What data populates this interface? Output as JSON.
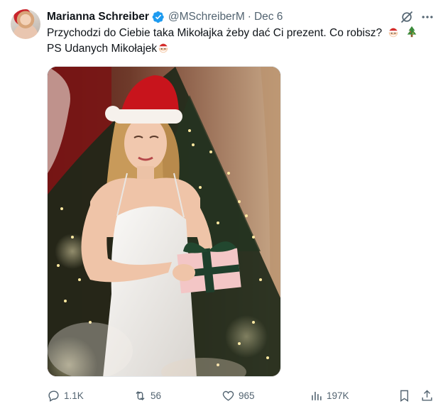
{
  "author": {
    "name": "Marianna Schreiber",
    "handle": "@MSchreiberM",
    "separator": "·",
    "date": "Dec 6"
  },
  "tweet": {
    "line1": "Przychodzi do Ciebie taka Mikołajka żeby dać Ci prezent. Co robisz?",
    "line2": "PS Udanych Mikołajek",
    "emojis_line1": [
      "santa-emoji",
      "christmas-tree-emoji"
    ],
    "emojis_line2": [
      "santa-emoji"
    ]
  },
  "media": {
    "description_icon": "photo",
    "colors": {
      "dress": "#f1efec",
      "hat": "#c8141c",
      "tree": "#1f2a1a",
      "gift": "#f3c6c6",
      "ribbon": "#1f3f2c"
    }
  },
  "actions": {
    "replies": "1.1K",
    "retweets": "56",
    "likes": "965",
    "views": "197K"
  },
  "colors": {
    "verified": "#1d9bf0",
    "secondary_text": "#536471",
    "primary_text": "#0f1419"
  }
}
